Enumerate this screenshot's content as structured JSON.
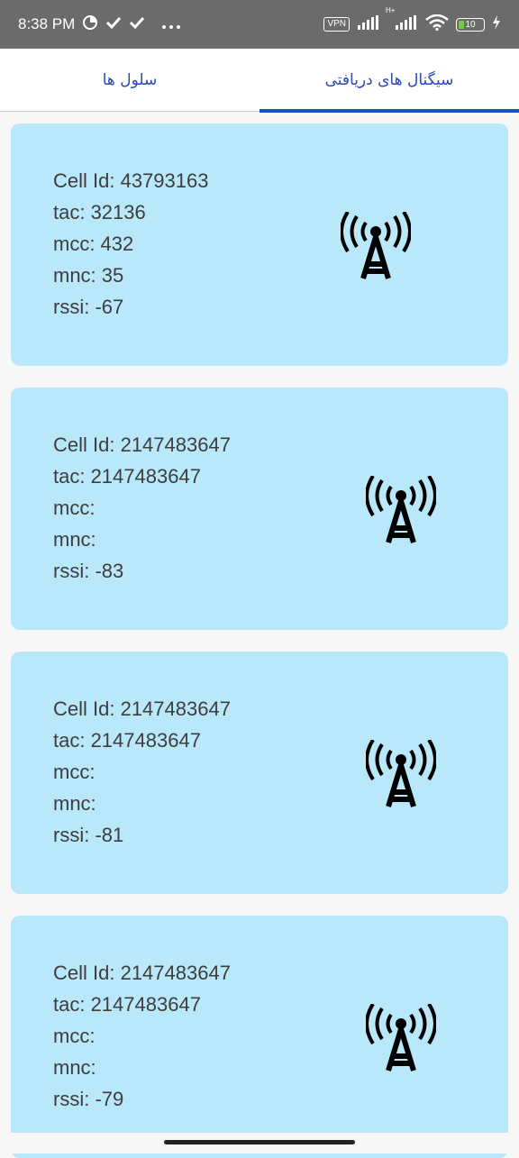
{
  "status_bar": {
    "time": "8:38 PM",
    "vpn": "VPN",
    "network_type": "H+",
    "battery_level": "10",
    "icons": [
      "data-saver-icon",
      "check-icon",
      "check-icon",
      "more-dots-icon",
      "signal-icon",
      "signal-icon",
      "wifi-icon",
      "battery-icon",
      "charging-icon"
    ]
  },
  "tabs": [
    {
      "label": "سیگنال های دریافتی",
      "active": true
    },
    {
      "label": "سلول ها",
      "active": false
    }
  ],
  "cells": [
    {
      "cell_id": "Cell Id: 43793163",
      "tac": "tac: 32136",
      "mcc": "mcc: 432",
      "mnc": "mnc: 35",
      "rssi": "rssi: -67"
    },
    {
      "cell_id": "Cell Id: 2147483647",
      "tac": "tac: 2147483647",
      "mcc": "mcc:",
      "mnc": "mnc:",
      "rssi": "rssi: -83"
    },
    {
      "cell_id": "Cell Id: 2147483647",
      "tac": "tac: 2147483647",
      "mcc": "mcc:",
      "mnc": "mnc:",
      "rssi": "rssi: -81"
    },
    {
      "cell_id": "Cell Id: 2147483647",
      "tac": "tac: 2147483647",
      "mcc": "mcc:",
      "mnc": "mnc:",
      "rssi": "rssi: -79"
    }
  ],
  "colors": {
    "card_background": "#bae8fb",
    "tab_accent": "#1f4fc6",
    "status_bar": "#6b6b6b"
  }
}
